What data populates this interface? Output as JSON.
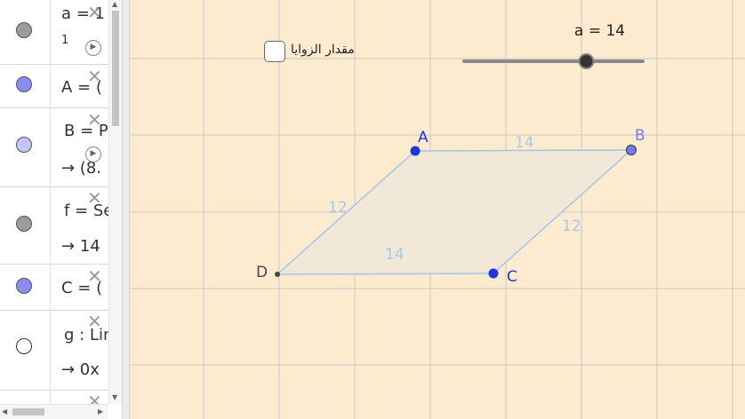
{
  "algebra_view": {
    "rows": [
      {
        "marker_color": "#9b9b9b",
        "line1": "a = 1",
        "line2": "1",
        "has_play": true
      },
      {
        "marker_color": "#8a8cf2",
        "line1": "A = (",
        "line2": "",
        "has_play": false
      },
      {
        "marker_color": "#c4c6f7",
        "line1": "B = P",
        "line2": "→  (8.",
        "has_play": true
      },
      {
        "marker_color": "#9b9b9b",
        "line1": "f = Se",
        "line2": "→  14",
        "has_play": false
      },
      {
        "marker_color": "#8a8cf2",
        "line1": "C = (",
        "line2": "",
        "has_play": false
      },
      {
        "marker_color": "#ffffff",
        "line1": "g : Lin",
        "line2": "→  0x",
        "has_play": false
      }
    ]
  },
  "graphics_view": {
    "checkbox": {
      "label": "مقدار الزوايا",
      "checked": false
    },
    "slider": {
      "label": "a = 14",
      "value": 14,
      "min": 1,
      "max": 20
    },
    "points": {
      "A": "A",
      "B": "B",
      "C": "C",
      "D": "D"
    },
    "segment_labels": {
      "AB": "14",
      "BC": "12",
      "CD": "14",
      "DA": "12"
    },
    "colors": {
      "background": "#fdebd0",
      "grid": "#c8c8c8",
      "polygon_fill": "#f2e8d8",
      "edge": "#9ec7ea",
      "segment_label": "#a3c9ee",
      "point": "#1f36d9",
      "point_label": "#1f36d9",
      "point_B": "#6f7df0"
    }
  }
}
